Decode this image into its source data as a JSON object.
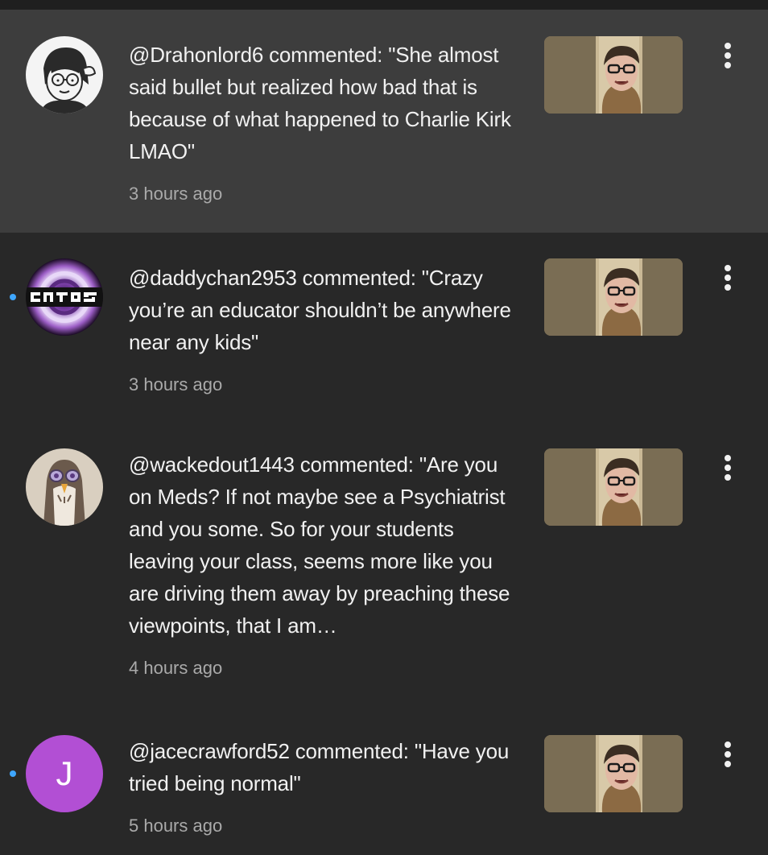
{
  "notifications": [
    {
      "comment": "@Drahonlord6 commented: \"She almost said bullet but realized how bad that is because of what happened to Charlie Kirk LMAO\"",
      "time": "3 hours ago",
      "avatar_icon": "cartoon-face-avatar",
      "unread": false,
      "highlighted": true
    },
    {
      "comment": "@daddychan2953 commented: \"Crazy you’re an educator shouldn’t be anywhere near any kids\"",
      "time": "3 hours ago",
      "avatar_icon": "swirl-logo-avatar",
      "unread": true,
      "highlighted": false
    },
    {
      "comment": "@wackedout1443 commented: \"Are you on Meds? If not maybe see a Psychiatrist and you some. So for your students leaving your class, seems more like you are driving them away by preaching these viewpoints, that I am…",
      "time": "4 hours ago",
      "avatar_icon": "owl-drawing-avatar",
      "unread": false,
      "highlighted": false
    },
    {
      "comment": "@jacecrawford52 commented: \"Have you tried being normal\"",
      "time": "5 hours ago",
      "avatar_letter": "J",
      "avatar_color": "#b24fd4",
      "unread": true,
      "highlighted": false
    }
  ],
  "colors": {
    "background": "#282828",
    "highlight": "#3d3d3d",
    "unread_dot": "#3ea6ff",
    "secondary_text": "#aaaaaa"
  }
}
